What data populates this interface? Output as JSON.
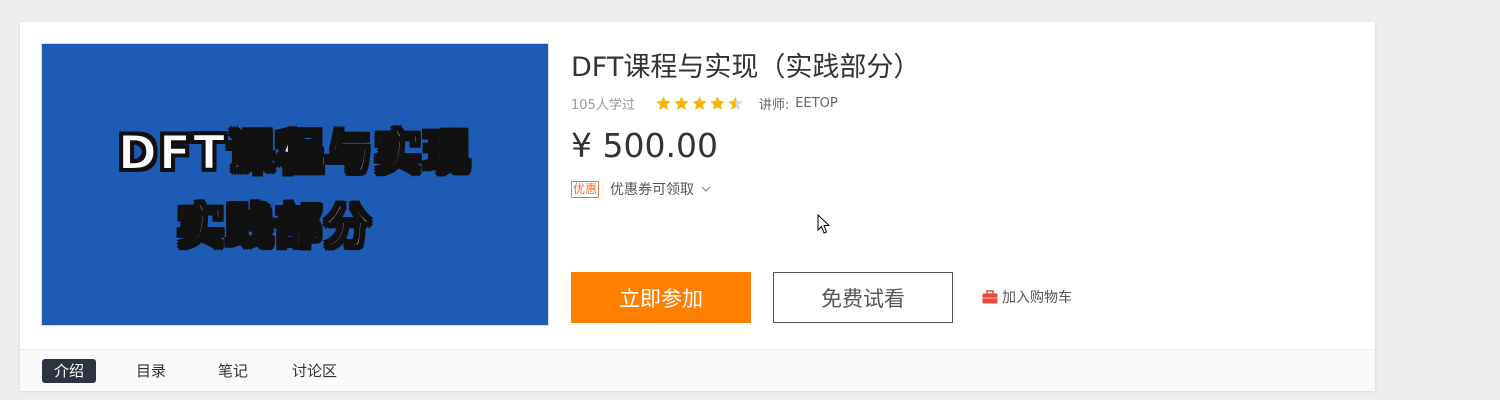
{
  "course": {
    "cover": {
      "line1": "DFT课程与实现",
      "line2": "实践部分",
      "background": "#1e5bb5"
    },
    "title": "DFT课程与实现（实践部分）",
    "learners": "105人学过",
    "rating": 4.5,
    "teacher_label": "讲师:",
    "teacher_name": "EETOP",
    "price": "¥ 500.00",
    "coupon_tag": "优惠",
    "coupon_text": "优惠券可领取",
    "coupon_icon": "chevron-down-icon"
  },
  "actions": {
    "join_label": "立即参加",
    "trial_label": "免费试看",
    "cart_label": "加入购物车",
    "cart_icon": "briefcase-icon",
    "join_color": "#ff7f00",
    "cart_icon_color": "#e8473c"
  },
  "tabs": [
    {
      "label": "介绍",
      "active": true
    },
    {
      "label": "目录",
      "active": false
    },
    {
      "label": "笔记",
      "active": false
    },
    {
      "label": "讨论区",
      "active": false
    }
  ]
}
